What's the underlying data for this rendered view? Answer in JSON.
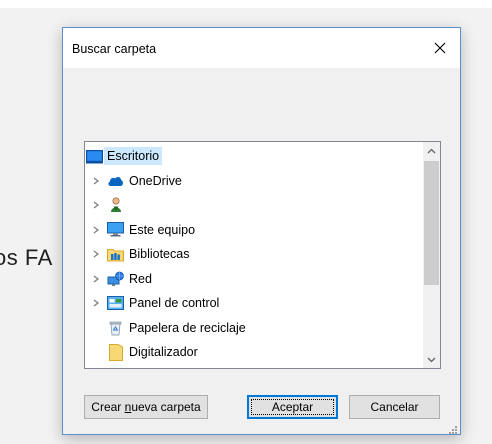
{
  "background": {
    "partial_text": "os FA"
  },
  "dialog": {
    "title": "Buscar carpeta",
    "close_glyph": "✕",
    "tree": {
      "items": [
        {
          "label": "Escritorio",
          "icon": "desktop-icon",
          "expander": false,
          "selected": true
        },
        {
          "label": "OneDrive",
          "icon": "onedrive-cloud-icon",
          "expander": true
        },
        {
          "label": "",
          "icon": "user-folder-icon",
          "expander": true
        },
        {
          "label": "Este equipo",
          "icon": "computer-icon",
          "expander": true
        },
        {
          "label": "Bibliotecas",
          "icon": "libraries-icon",
          "expander": true
        },
        {
          "label": "Red",
          "icon": "network-icon",
          "expander": true
        },
        {
          "label": "Panel de control",
          "icon": "control-panel-icon",
          "expander": true
        },
        {
          "label": "Papelera de reciclaje",
          "icon": "recycle-bin-icon",
          "expander": false
        },
        {
          "label": "Digitalizador",
          "icon": "folder-icon",
          "expander": false
        }
      ]
    },
    "buttons": {
      "new_folder_prefix": "Crear ",
      "new_folder_accel": "n",
      "new_folder_suffix": "ueva carpeta",
      "ok": "Aceptar",
      "cancel": "Cancelar"
    }
  },
  "colors": {
    "selection": "#cce8ff",
    "accent": "#0078d7",
    "dialog_border": "#5a8fd6"
  }
}
